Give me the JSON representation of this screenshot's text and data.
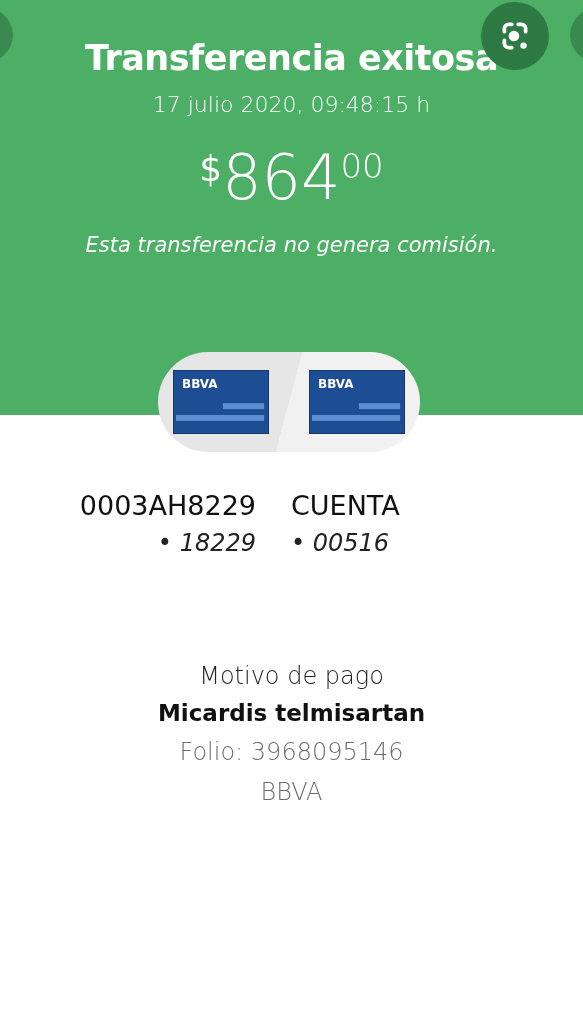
{
  "header": {
    "title": "Transferencia exitosa",
    "datetime": "17 julio 2020, 09:48:15 h",
    "amount": {
      "currency": "$",
      "whole": "864",
      "cents": "00"
    },
    "note": "Esta transferencia no genera comisión."
  },
  "cards": [
    {
      "brand": "BBVA"
    },
    {
      "brand": "BBVA"
    }
  ],
  "accounts": [
    {
      "name": "0003AH8229",
      "number": "• 18229"
    },
    {
      "name": "CUENTA",
      "number": "• 00516"
    }
  ],
  "details": {
    "label": "Motivo de pago",
    "concept": "Micardis telmisartan",
    "folio": "Folio: 3968095146",
    "bank": "BBVA"
  }
}
